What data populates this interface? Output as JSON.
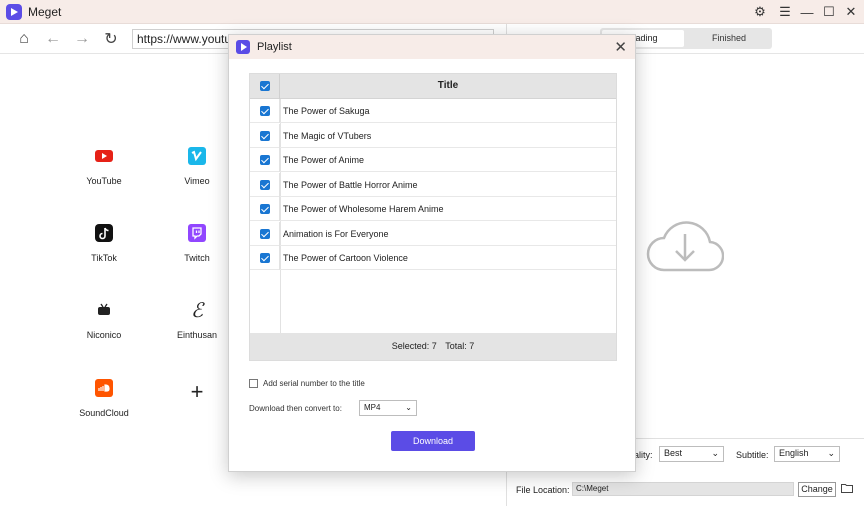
{
  "app": {
    "title": "Meget"
  },
  "browser": {
    "url": "https://www.youtub"
  },
  "sites": [
    {
      "label": "YouTube",
      "icon": "youtube-icon",
      "color": "#e62117"
    },
    {
      "label": "Vimeo",
      "icon": "vimeo-icon",
      "color": "#1ab7ea"
    },
    {
      "label": "TikTok",
      "icon": "tiktok-icon",
      "color": "#111111"
    },
    {
      "label": "Twitch",
      "icon": "twitch-icon",
      "color": "#9146ff"
    },
    {
      "label": "Niconico",
      "icon": "niconico-icon",
      "color": "#222222"
    },
    {
      "label": "Einthusan",
      "icon": "einthusan-icon",
      "color": "#222222"
    },
    {
      "label": "SoundCloud",
      "icon": "soundcloud-icon",
      "color": "#ff5500"
    },
    {
      "label": "",
      "icon": "plus-icon",
      "color": "#222222"
    }
  ],
  "tabs": {
    "downloading": "loading",
    "finished": "Finished"
  },
  "bottom": {
    "quality_label": "ality:",
    "quality_value": "Best",
    "subtitle_label": "Subtitle:",
    "subtitle_value": "English",
    "file_location_label": "File Location:",
    "file_location_value": "C:\\Meget",
    "change_label": "Change"
  },
  "dialog": {
    "title": "Playlist",
    "column_title": "Title",
    "items": [
      "The Power of Sakuga",
      "The Magic of VTubers",
      "The Power of Anime",
      "The Power of Battle Horror Anime",
      "The Power of Wholesome Harem Anime",
      "Animation is For Everyone",
      "The Power of Cartoon Violence"
    ],
    "selected_text": "Selected: 7",
    "total_text": "Total: 7",
    "serial_label": "Add serial number to the title",
    "convert_label": "Download then convert to:",
    "convert_value": "MP4",
    "download_label": "Download"
  },
  "colors": {
    "accent": "#5b4ce6",
    "checkbox": "#1976d2"
  }
}
